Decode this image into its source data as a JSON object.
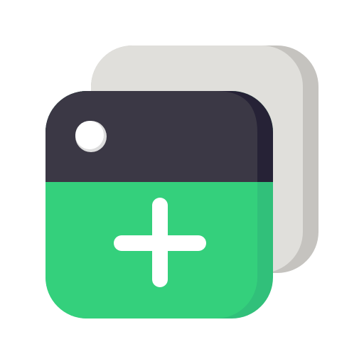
{
  "icon": {
    "name": "add-new-tab-icon",
    "colors": {
      "background_card": "#e0dfdb",
      "background_card_shadow": "#c5c3bf",
      "header": "#3b3845",
      "header_shadow": "#262236",
      "body": "#34d07c",
      "body_shadow": "#31c07a",
      "dot": "#ffffff",
      "dot_shadow": "#dddddd",
      "plus": "#ffffff"
    }
  }
}
